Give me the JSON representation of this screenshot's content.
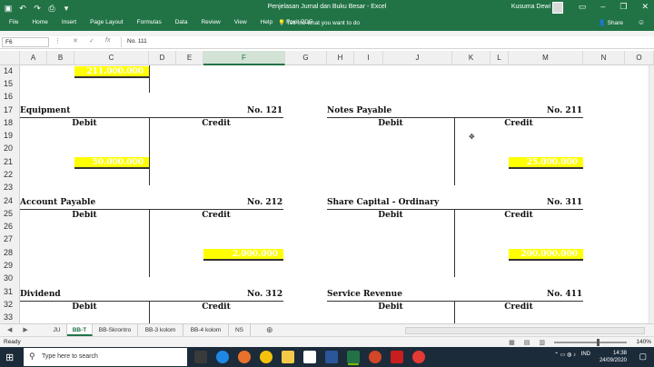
{
  "window": {
    "title": "Penjelasan Jurnal dan Buku Besar  -  Excel",
    "user": "Kusuma Dewi"
  },
  "ribbon": {
    "tabs": [
      "File",
      "Home",
      "Insert",
      "Page Layout",
      "Formulas",
      "Data",
      "Review",
      "View",
      "Help",
      "Foxit PDF"
    ],
    "tell_me": "Tell me what you want to do",
    "share": "Share"
  },
  "formula_bar": {
    "name_box": "F6",
    "formula": "No. 111"
  },
  "columns": [
    "A",
    "B",
    "C",
    "D",
    "E",
    "F",
    "G",
    "H",
    "I",
    "J",
    "K",
    "L",
    "M",
    "N",
    "O"
  ],
  "selected_column": "F",
  "rows": [
    "14",
    "15",
    "16",
    "17",
    "18",
    "19",
    "20",
    "21",
    "22",
    "23",
    "24",
    "25",
    "26",
    "27",
    "28",
    "29",
    "30",
    "31",
    "32",
    "33"
  ],
  "ledger": {
    "top_value": "211.000.000",
    "debit": "Debit",
    "credit": "Credit",
    "accounts": [
      {
        "name": "Equipment",
        "no": "No. 121",
        "value": "50.000.000"
      },
      {
        "name": "Notes Payable",
        "no": "No. 211",
        "value": "25.000.000"
      },
      {
        "name": "Account Payable",
        "no": "No. 212",
        "value": "2.000.000"
      },
      {
        "name": "Share Capital - Ordinary",
        "no": "No. 311",
        "value": "200.000.000"
      },
      {
        "name": "Dividend",
        "no": "No. 312"
      },
      {
        "name": "Service Revenue",
        "no": "No. 411"
      }
    ]
  },
  "sheets": [
    "JU",
    "BB-T",
    "BB-Skrontro",
    "BB-3 kolom",
    "BB-4 kolom",
    "NS"
  ],
  "active_sheet": "BB-T",
  "status": {
    "ready": "Ready",
    "zoom": "140%"
  },
  "taskbar": {
    "search_placeholder": "Type here to search",
    "language": "IND",
    "time": "14:38",
    "date": "24/09/2020"
  },
  "colors": {
    "excel_green": "#217346",
    "highlight": "#ffff00"
  }
}
